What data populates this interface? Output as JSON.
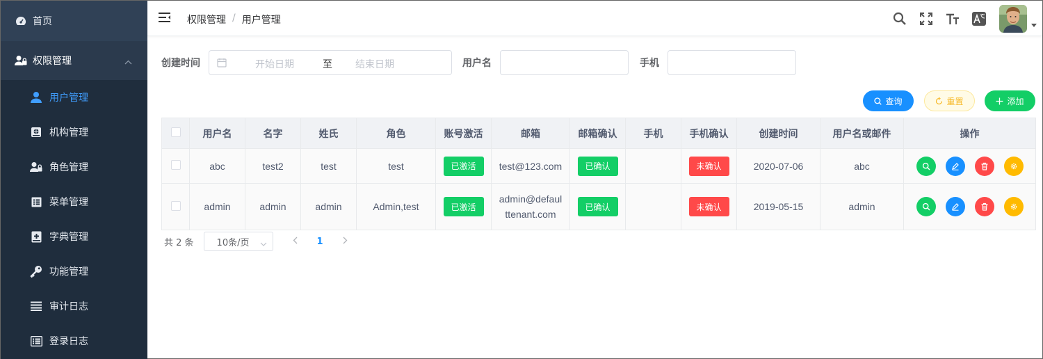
{
  "sidebar": {
    "home": {
      "label": "首页",
      "icon": "dashboard-icon"
    },
    "group": {
      "label": "权限管理",
      "icon": "user-lock-icon"
    },
    "items": [
      {
        "label": "用户管理",
        "icon": "user-icon",
        "active": true
      },
      {
        "label": "机构管理",
        "icon": "building-icon"
      },
      {
        "label": "角色管理",
        "icon": "user-lock-icon"
      },
      {
        "label": "菜单管理",
        "icon": "menu-list-icon"
      },
      {
        "label": "字典管理",
        "icon": "book-plus-icon"
      },
      {
        "label": "功能管理",
        "icon": "key-icon"
      },
      {
        "label": "审计日志",
        "icon": "lines-icon"
      },
      {
        "label": "登录日志",
        "icon": "log-list-icon"
      }
    ]
  },
  "breadcrumb": {
    "parent": "权限管理",
    "separator": "/",
    "current": "用户管理"
  },
  "filter": {
    "created_label": "创建时间",
    "start_placeholder": "开始日期",
    "to": "至",
    "end_placeholder": "结束日期",
    "username_label": "用户名",
    "phone_label": "手机"
  },
  "actions": {
    "query": "查询",
    "reset": "重置",
    "add": "添加"
  },
  "table": {
    "headers": [
      "用户名",
      "名字",
      "姓氏",
      "角色",
      "账号激活",
      "邮箱",
      "邮箱确认",
      "手机",
      "手机确认",
      "创建时间",
      "用户名或邮件",
      "操作"
    ],
    "rows": [
      {
        "username": "abc",
        "name": "test2",
        "surname": "test",
        "role": "test",
        "active": "已激活",
        "email": "test@123.com",
        "email_confirmed": "已确认",
        "phone": "",
        "phone_confirmed": "未确认",
        "created": "2020-07-06",
        "user_or_email": "abc"
      },
      {
        "username": "admin",
        "name": "admin",
        "surname": "admin",
        "role": "Admin,test",
        "active": "已激活",
        "email": "admin@defaul ttenant.com",
        "email_confirmed": "已确认",
        "phone": "",
        "phone_confirmed": "未确认",
        "created": "2019-05-15",
        "user_or_email": "admin"
      }
    ]
  },
  "pagination": {
    "total": "共 2 条",
    "page_size": "10条/页",
    "current_page": "1"
  },
  "colors": {
    "sidebar": "#304156",
    "submenu": "#1f2d3d",
    "accent": "#1890ff",
    "success": "#13ce66",
    "danger": "#ff4949",
    "warning": "#ffba00"
  }
}
